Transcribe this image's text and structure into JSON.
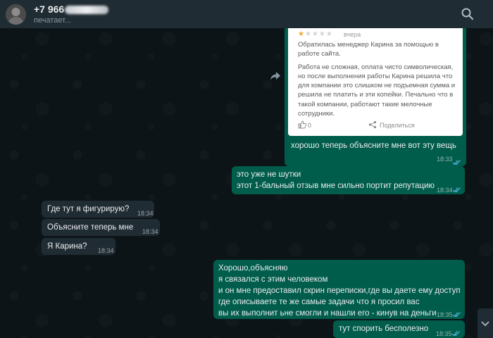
{
  "header": {
    "contact_name": "+7 966",
    "status": "печатает..."
  },
  "forwarded_screenshot": {
    "rating": "1",
    "date": "вчера",
    "review_paragraphs": [
      [
        "Обратилась менеджер Карина за помощью в",
        "работе сайта."
      ],
      [
        "Работа не сложная, оплата чисто символическая,",
        "но после выполнения работы Карина решила что",
        "для компании это слишком не подъемная сумма и",
        "решила не платить и эти копейки. Печально что в",
        "такой компании, работают такие мелочные",
        "сотрудники."
      ]
    ],
    "like_count": "0",
    "share_label": "Поделиться"
  },
  "messages": [
    {
      "dir": "out",
      "lines": [
        "хорошо",
        "теперь объясните мне вот эту вещь"
      ],
      "time": "18:33",
      "read": true
    },
    {
      "dir": "out",
      "lines": [
        "это уже не шутки",
        "этот 1-бальный отзыв мне сильно портит репутацию"
      ],
      "time": "18:34",
      "read": true
    },
    {
      "dir": "in",
      "lines": [
        "Где тут я фигурирую?"
      ],
      "time": "18:34"
    },
    {
      "dir": "in",
      "lines": [
        "Объясните теперь мне"
      ],
      "time": "18:34"
    },
    {
      "dir": "in",
      "lines": [
        "Я Карина?"
      ],
      "time": "18:34"
    },
    {
      "dir": "out",
      "lines": [
        "Хорошо,объясняю",
        "я связался с этим человеком",
        "и он мне предоставил скрин переписки,где вы даете ему доступ",
        "где описываете те же самые задачи что я просил вас",
        "вы их выполнит ьне смогли и нашли его - кинув на деньги"
      ],
      "time": "18:35",
      "read": true
    },
    {
      "dir": "out",
      "lines": [
        "тут спорить бесполезно"
      ],
      "time": "18:35",
      "read": true
    }
  ],
  "colors": {
    "outgoing_bubble": "#005c4b",
    "incoming_bubble": "#202c33",
    "header": "#202c33",
    "read_ticks": "#53bdeb",
    "star": "#f5a623"
  },
  "icons": [
    "avatar",
    "search-icon",
    "forward-icon",
    "read-ticks-icon",
    "thumbs-up-icon",
    "share-icon",
    "chevron-down-icon"
  ]
}
